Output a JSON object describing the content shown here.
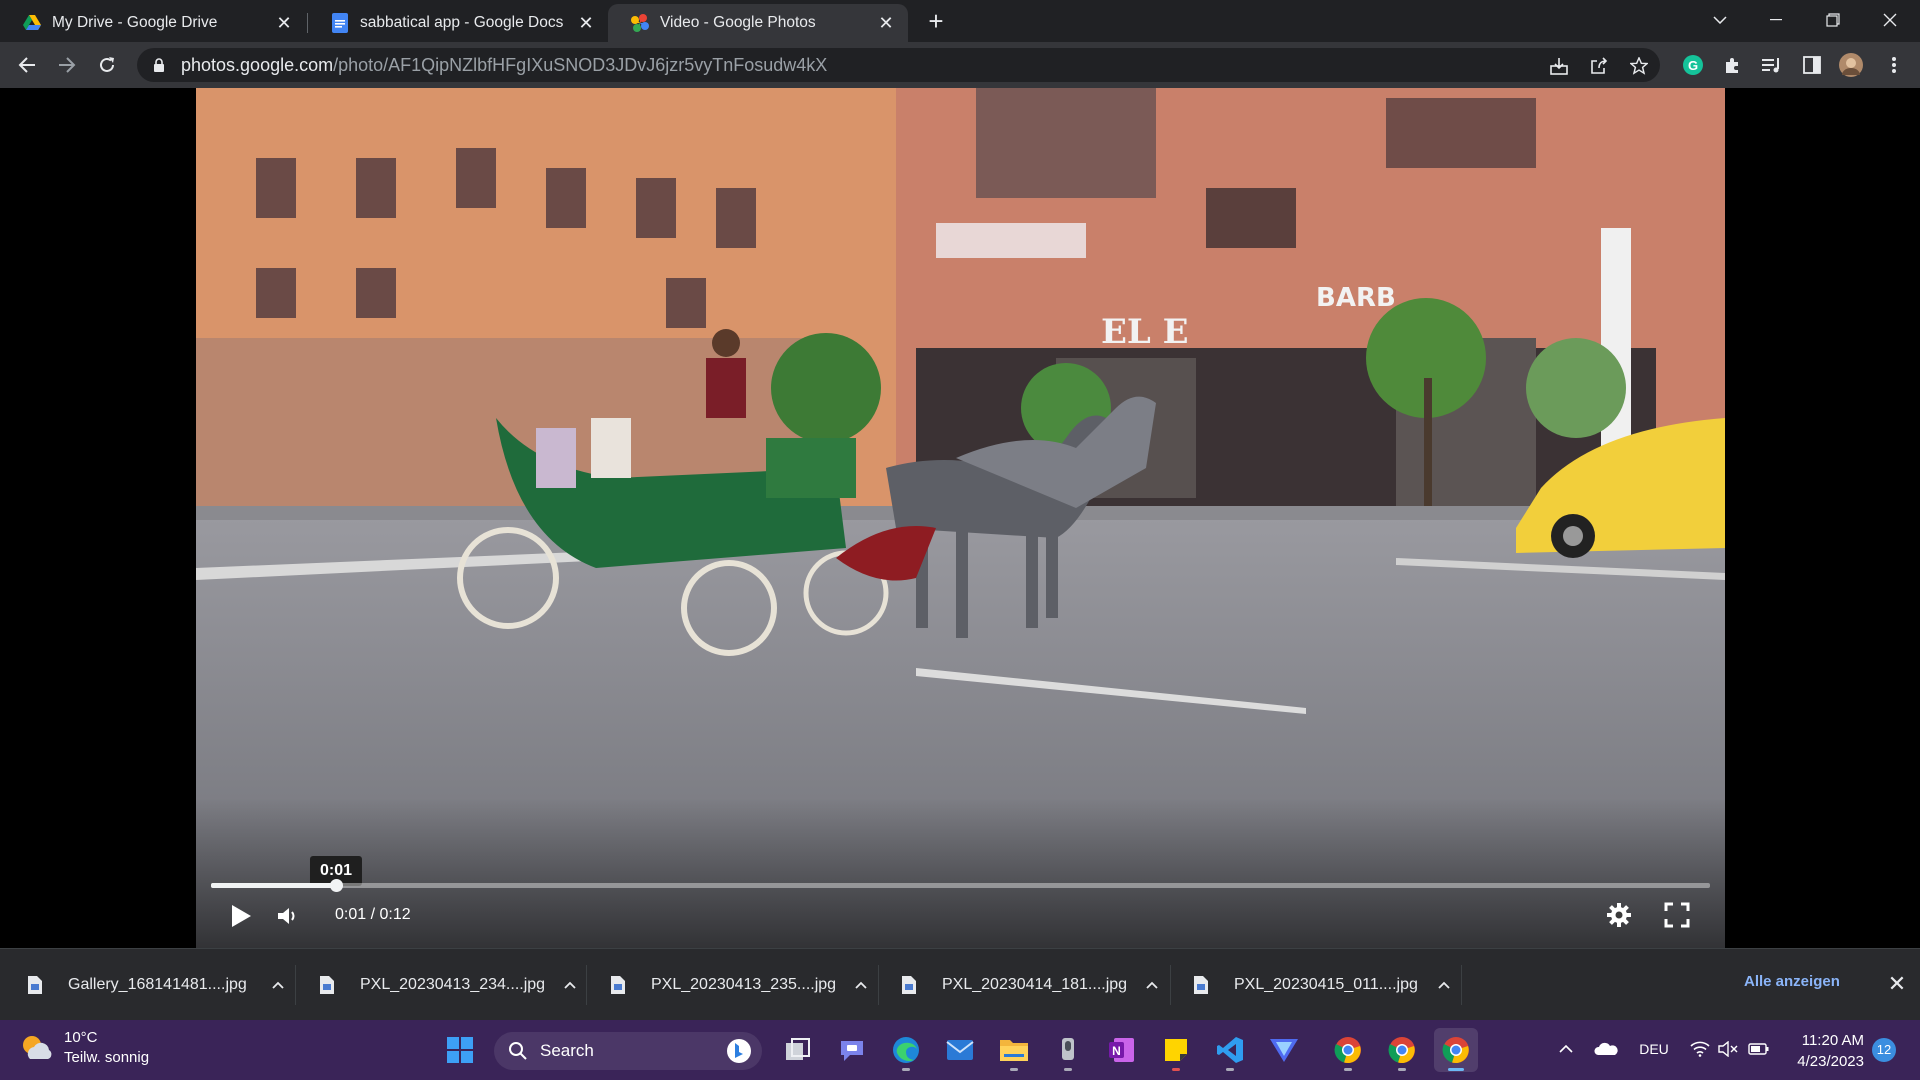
{
  "browser": {
    "tabs": [
      {
        "title": "My Drive - Google Drive",
        "icon": "google-drive-icon"
      },
      {
        "title": "sabbatical app - Google Docs",
        "icon": "google-docs-icon"
      },
      {
        "title": "Video - Google Photos",
        "icon": "google-photos-icon",
        "active": true
      }
    ],
    "url_host": "photos.google.com",
    "url_path": "/photo/AF1QipNZlbfHFgIXuSNOD3JDvJ6jzr5vyTnFosudw4kX"
  },
  "player": {
    "tooltip_time": "0:01",
    "time_readout": "0:01 / 0:12",
    "progress": 0.0834,
    "sign_barber": "BARB",
    "sign_shop": "EL   E"
  },
  "downloads": {
    "items": [
      {
        "name": "Gallery_168141481....jpg"
      },
      {
        "name": "PXL_20230413_234....jpg"
      },
      {
        "name": "PXL_20230413_235....jpg"
      },
      {
        "name": "PXL_20230414_181....jpg"
      },
      {
        "name": "PXL_20230415_011....jpg"
      }
    ],
    "show_all": "Alle anzeigen"
  },
  "taskbar": {
    "weather_temp": "10°C",
    "weather_desc": "Teilw. sonnig",
    "search_label": "Search",
    "language": "DEU",
    "time": "11:20 AM",
    "date": "4/23/2023",
    "notifications": "12"
  },
  "colors": {
    "accent": "#8ab4f8",
    "taskbar": "#3a2458",
    "chrome_dark": "#202124"
  }
}
